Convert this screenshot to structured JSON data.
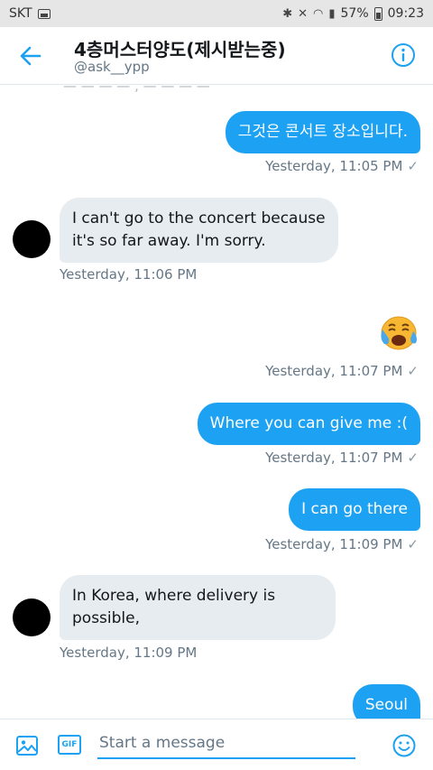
{
  "status_bar": {
    "carrier": "SKT",
    "battery": "57%",
    "time": "09:23"
  },
  "header": {
    "title": "4층머스터양도(제시받는중)",
    "handle": "@ask__ypp",
    "back_icon": "back-arrow-icon",
    "info_icon": "info-icon"
  },
  "messages": [
    {
      "direction": "out",
      "text": "그것은 콘서트 장소입니다.",
      "time": "Yesterday, 11:05 PM"
    },
    {
      "direction": "in",
      "text": "I can't go to the concert because it's so far away. I'm sorry.",
      "line1": "I can't go to the concert because",
      "line2": "it's so far away. I'm sorry.",
      "time": "Yesterday, 11:06 PM"
    },
    {
      "direction": "out",
      "emoji": "crying-face",
      "time": "Yesterday, 11:07 PM"
    },
    {
      "direction": "out",
      "text": "Where you can give me :(",
      "time": "Yesterday, 11:07 PM"
    },
    {
      "direction": "out",
      "text": "I can go there",
      "time": "Yesterday, 11:09 PM"
    },
    {
      "direction": "in",
      "text": "In Korea, where delivery is possible,",
      "line1": "In Korea, where delivery is",
      "line2": "possible,",
      "time": "Yesterday, 11:09 PM"
    },
    {
      "direction": "out",
      "text": "Seoul"
    }
  ],
  "composer": {
    "placeholder": "Start a message",
    "gif_label": "GIF",
    "image_icon": "image-icon",
    "emoji_icon": "smiley-icon"
  },
  "colors": {
    "accent": "#1da1f2",
    "incoming_bubble": "#e6ecf0",
    "muted_text": "#657786"
  }
}
